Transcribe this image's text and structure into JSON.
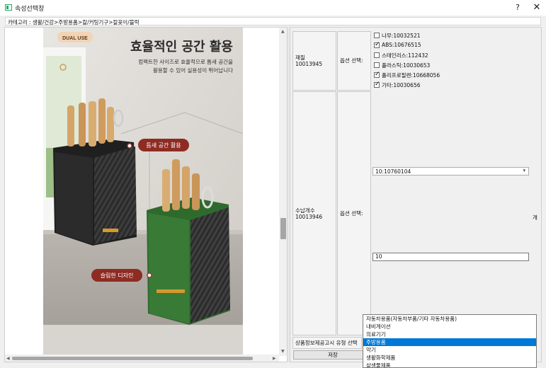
{
  "window": {
    "title": "속성선택창",
    "help": "?",
    "close": "✕"
  },
  "category": {
    "text": "카테고리 : 생활/건강>주방용품>칼/커팅기구>칼꽂이/블럭"
  },
  "product_image": {
    "badge": "DUAL USE",
    "headline": "효율적인 공간 활용",
    "subtext_1": "컴팩트한 사이즈로 효율적으로 틈새 공간을",
    "subtext_2": "활용할 수 있어 실용성이 뛰어납니다",
    "callout_1": "틈새 공간 활용",
    "callout_2": "슬림한 디자인"
  },
  "attributes": [
    {
      "name": "재질",
      "code": "10013945",
      "option_label": "옵션 선택:",
      "options": [
        {
          "label": "나무:10032521",
          "checked": false
        },
        {
          "label": "ABS:10676515",
          "checked": true
        },
        {
          "label": "스테인리스:112432",
          "checked": false
        },
        {
          "label": "플라스틱:10030653",
          "checked": false
        },
        {
          "label": "폴리프로필렌:10668056",
          "checked": true
        },
        {
          "label": "기타:10030656",
          "checked": true
        }
      ]
    },
    {
      "name": "수납개수",
      "code": "10013946",
      "option_label": "옵션 선택:",
      "select_value": "10:10760104",
      "input_value": "10",
      "unit": "개"
    }
  ],
  "notice": {
    "label": "상품정보제공고시 유형 선택"
  },
  "save_button": "저장",
  "dropdown": {
    "items": [
      "자동차용품(자동차부품/기타 자동차용품)",
      "내비게이션",
      "의료기기",
      "주방용품",
      "악기",
      "생활화학제품",
      "살생물제품"
    ],
    "selected_index": 3
  }
}
